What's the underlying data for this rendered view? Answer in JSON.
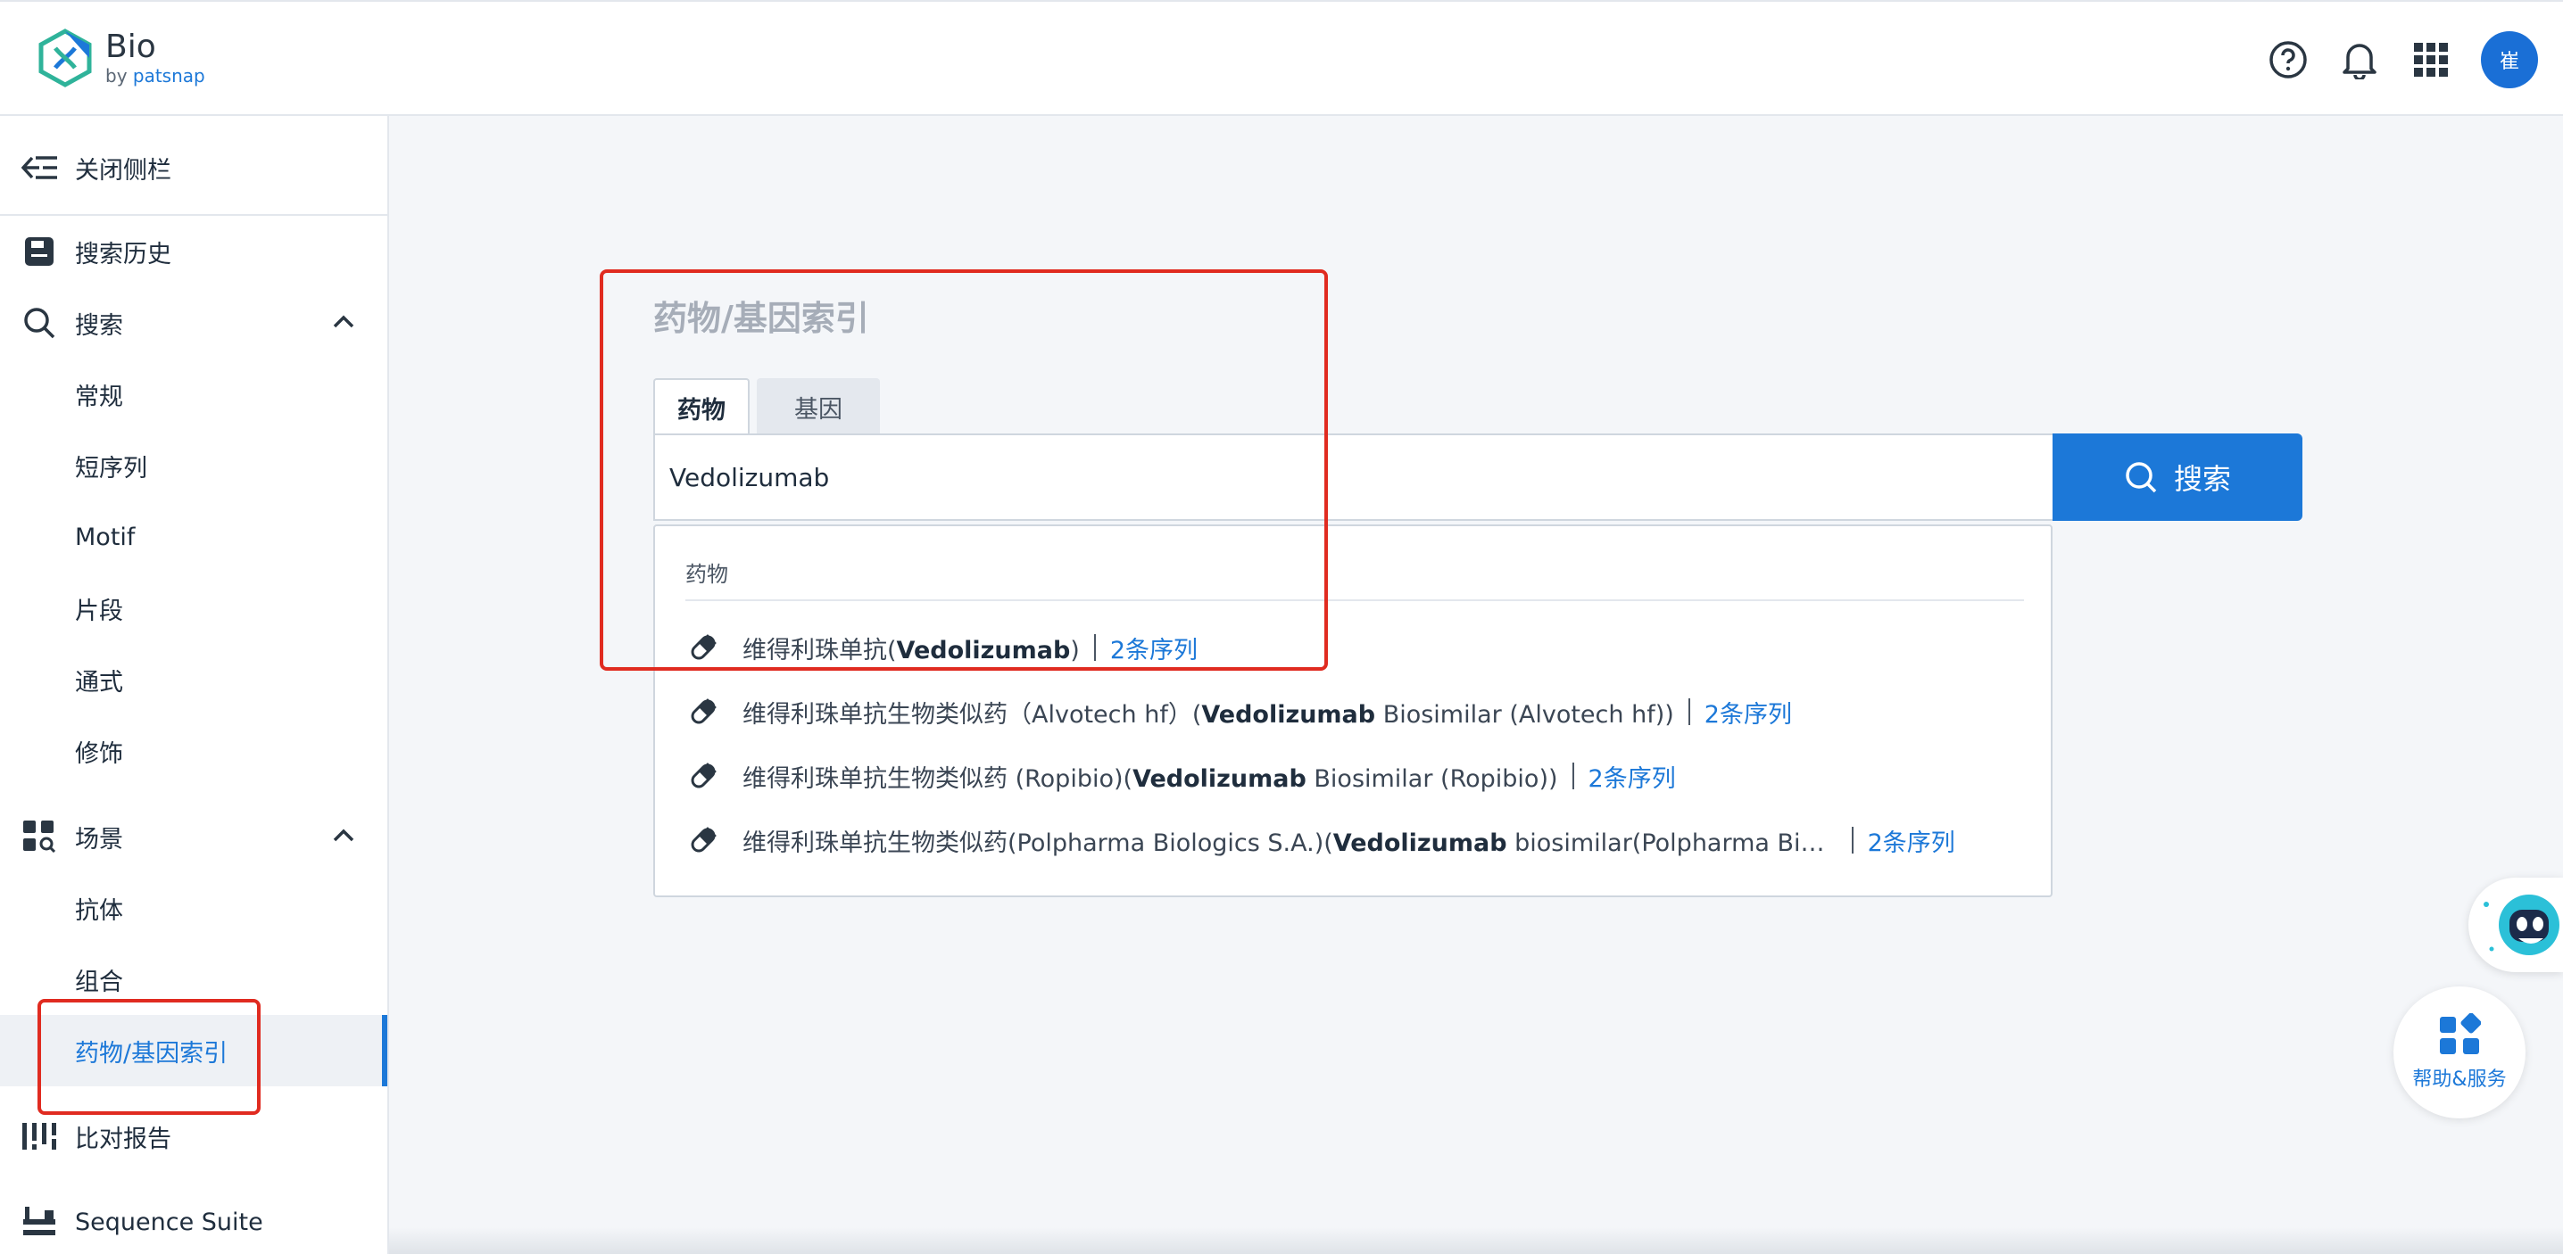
{
  "app": {
    "logo_title": "Bio",
    "logo_sub_prefix": "by ",
    "logo_sub_brand": "patsnap"
  },
  "header": {
    "icons": [
      "help-icon",
      "bell-icon",
      "apps-grid-icon"
    ],
    "avatar_text": "崔"
  },
  "sidebar": {
    "close_label": "关闭侧栏",
    "history_label": "搜索历史",
    "search_label": "搜索",
    "search_items": [
      "常规",
      "短序列",
      "Motif",
      "片段",
      "通式",
      "修饰"
    ],
    "scenario_label": "场景",
    "scenario_items": [
      "抗体",
      "组合",
      "药物/基因索引"
    ],
    "compare_label": "比对报告",
    "suite_label": "Sequence Suite"
  },
  "main": {
    "title": "药物/基因索引",
    "tabs": [
      "药物",
      "基因"
    ],
    "search_value": "Vedolizumab",
    "search_button": "搜索",
    "dropdown_header": "药物",
    "results": [
      {
        "prefix": "维得利珠单抗(",
        "bold": "Vedolizumab",
        "suffix": ")",
        "seq": "2条序列"
      },
      {
        "prefix": "维得利珠单抗生物类似药（Alvotech hf）(",
        "bold": "Vedolizumab",
        "suffix": " Biosimilar (Alvotech hf))",
        "seq": "2条序列"
      },
      {
        "prefix": "维得利珠单抗生物类似药 (Ropibio)(",
        "bold": "Vedolizumab",
        "suffix": " Biosimilar (Ropibio))",
        "seq": "2条序列"
      },
      {
        "prefix": "维得利珠单抗生物类似药(Polpharma Biologics S.A.)(",
        "bold": "Vedolizumab",
        "suffix": " biosimilar(Polpharma Bi…",
        "seq": "2条序列"
      }
    ]
  },
  "widgets": {
    "help_label": "帮助&服务"
  },
  "colors": {
    "accent": "#1c78d8",
    "highlight": "#e02b20"
  }
}
